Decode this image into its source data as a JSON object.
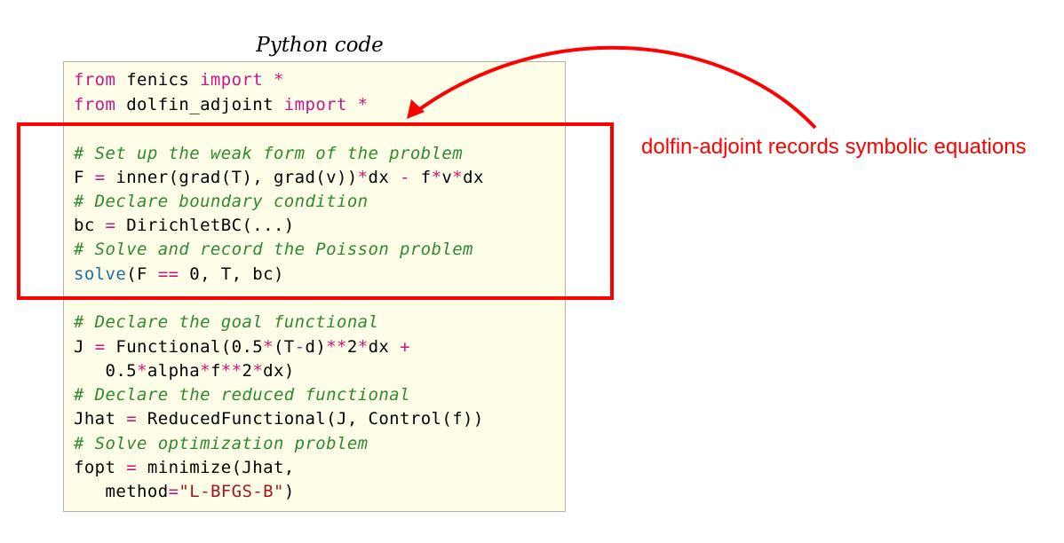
{
  "caption": "Python code",
  "annotation": "dolfin-adjoint records symbolic equations",
  "colors": {
    "keyword": "#c8168c",
    "operator": "#d31477",
    "builtin": "#1f6ea8",
    "comment": "#2f8a2f",
    "string": "#a0161f",
    "highlight": "#ff0000",
    "code_background": "#fefee8"
  },
  "code": {
    "l1": {
      "kw1": "from",
      "mod": " fenics ",
      "kw2": "import",
      "star": " *"
    },
    "l2": {
      "kw1": "from",
      "mod": " dolfin_adjoint ",
      "kw2": "import",
      "star": " *"
    },
    "l3": {
      "comment": "# Set up the weak form of the problem"
    },
    "l4": {
      "lhs": "F ",
      "eq": "=",
      "a": " inner(grad(T), grad(v))",
      "m1": "*",
      "b": "dx ",
      "minus": "-",
      "c": " f",
      "m2": "*",
      "d": "v",
      "m3": "*",
      "e": "dx"
    },
    "l5": {
      "comment": "# Declare boundary condition"
    },
    "l6": {
      "lhs": "bc ",
      "eq": "=",
      "rhs": " DirichletBC(...)"
    },
    "l7": {
      "comment": "# Solve and record the Poisson problem"
    },
    "l8": {
      "fn": "solve",
      "a": "(F ",
      "eqeq": "==",
      "b": " 0, T, bc)"
    },
    "l9": {
      "comment": "# Declare the goal functional"
    },
    "l10": {
      "lhs": "J ",
      "eq": "=",
      "a": " Functional(0.5",
      "m1": "*",
      "b": "(T",
      "minus": "-",
      "c": "d)",
      "pow": "**",
      "d": "2",
      "m2": "*",
      "e": "dx ",
      "plus": "+"
    },
    "l11": {
      "indent": "   ",
      "a": "0.5",
      "m1": "*",
      "b": "alpha",
      "m2": "*",
      "c": "f",
      "pow": "**",
      "d": "2",
      "m3": "*",
      "e": "dx)"
    },
    "l12": {
      "comment": "# Declare the reduced functional"
    },
    "l13": {
      "lhs": "Jhat ",
      "eq": "=",
      "rhs": " ReducedFunctional(J, Control(f))"
    },
    "l14": {
      "comment": "# Solve optimization problem"
    },
    "l15": {
      "lhs": "fopt ",
      "eq": "=",
      "rhs": " minimize(Jhat,"
    },
    "l16": {
      "indent": "   ",
      "a": "method",
      "eq": "=",
      "str": "\"L-BFGS-B\"",
      "close": ")"
    }
  }
}
